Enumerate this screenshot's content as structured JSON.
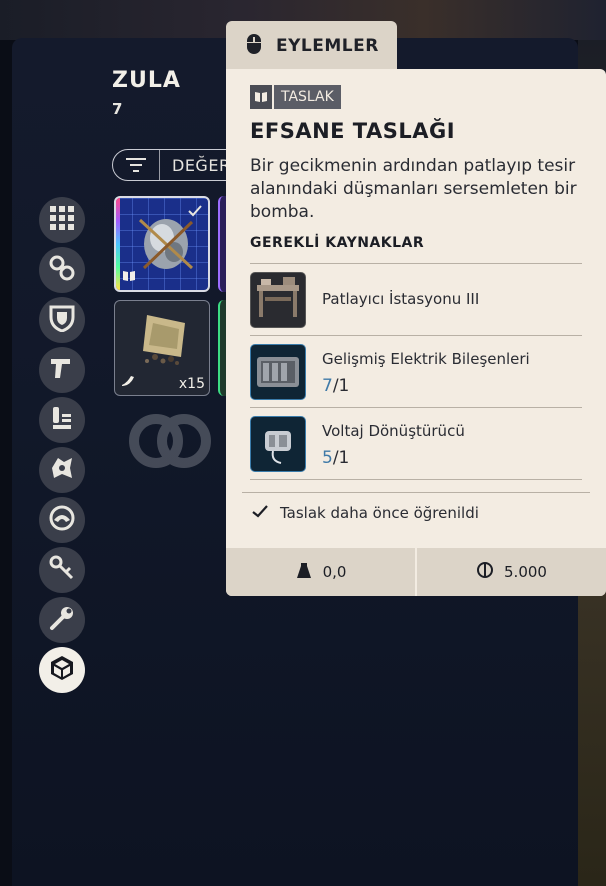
{
  "stash": {
    "title": "ZULA",
    "count": "7",
    "sort_label": "DEĞER",
    "categories": [
      "grid-icon",
      "chain-icon",
      "shield-icon",
      "gun-icon",
      "ammo-icon",
      "gear-icon",
      "ring-icon",
      "key-icon",
      "wrench-icon",
      "blueprint-cube-icon"
    ],
    "active_category": "blueprint-cube-icon",
    "slots": [
      {
        "item": "bomb-blueprint",
        "badge": "blueprint-icon",
        "selected": true
      },
      {
        "item": "material-pile",
        "badge": "material-icon",
        "quantity": "x15"
      }
    ]
  },
  "tooltip": {
    "actions_label": "EYLEMLER",
    "badge": "TASLAK",
    "title": "EFSANE TASLAĞI",
    "description": "Bir gecikmenin ardından patlayıp tesir alanındaki düşmanları sersemleten bir bomba.",
    "requirements_header": "GEREKLİ KAYNAKLAR",
    "requirements": [
      {
        "name": "Patlayıcı İstasyonu III",
        "have": "",
        "need": ""
      },
      {
        "name": "Gelişmiş Elektrik Bileşenleri",
        "have": "7",
        "need": "/1"
      },
      {
        "name": "Voltaj Dönüştürücü",
        "have": "5",
        "need": "/1"
      }
    ],
    "learned_text": "Taslak daha önce öğrenildi",
    "weight": "0,0",
    "value": "5.000"
  },
  "colors": {
    "tooltip_bg": "#f3ece2",
    "footer_bg": "#dcd4c8",
    "have_count": "#3f7aa8",
    "panel_bg": "#111829"
  }
}
